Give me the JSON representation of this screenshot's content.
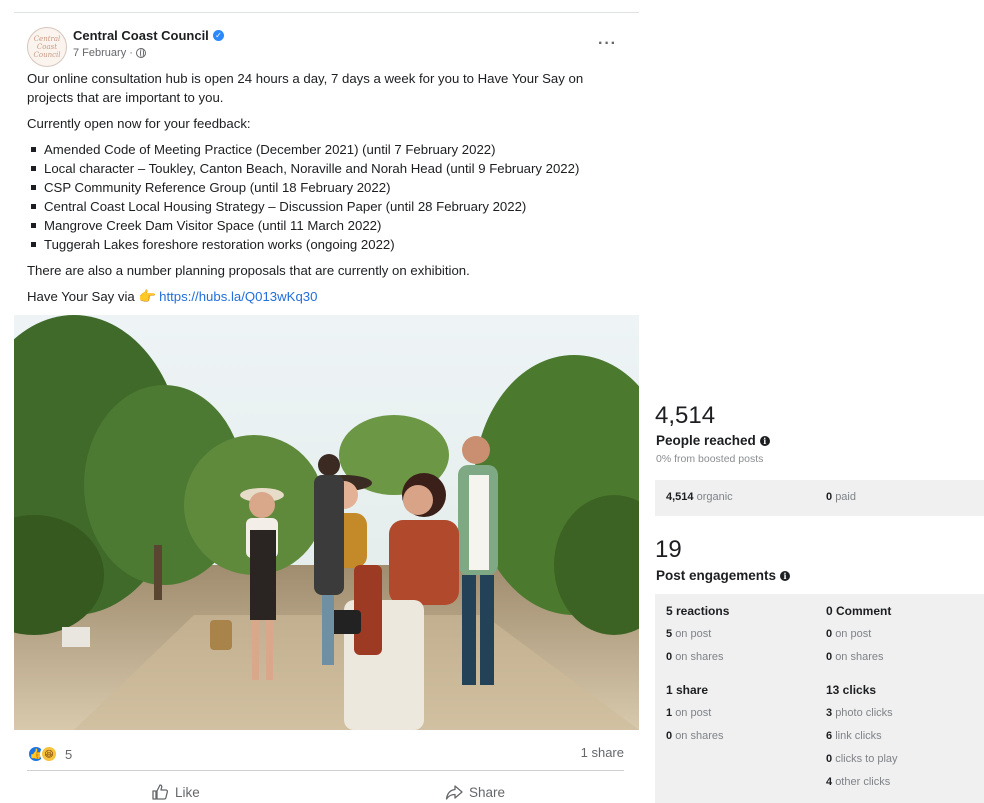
{
  "post": {
    "author": "Central Coast Council",
    "avatar_text": "Central Coast Council",
    "date": "7 February",
    "meta_sep": "·",
    "intro": "Our online consultation hub is open 24 hours a day, 7 days a week for you to Have Your Say on projects that are important to you.",
    "open_heading": "Currently open now for your feedback:",
    "items": [
      "Amended Code of Meeting Practice (December 2021) (until 7 February 2022)",
      "Local character – Toukley, Canton Beach, Noraville and Norah Head (until 9 February 2022)",
      "CSP Community Reference Group (until 18 February 2022)",
      "Central Coast Local Housing Strategy – Discussion Paper (until 28 February 2022)",
      "Mangrove Creek Dam Visitor Space (until 11 March 2022)",
      "Tuggerah Lakes foreshore restoration works (ongoing 2022)"
    ],
    "exhibition": "There are also a number planning proposals that are currently on exhibition.",
    "cta_prefix": "Have Your Say via",
    "cta_icon": "👉",
    "cta_link": "https://hubs.la/Q013wKq30",
    "reaction_count": "5",
    "share_count": "1 share",
    "like_label": "Like",
    "share_label": "Share",
    "more_label": "···"
  },
  "insights": {
    "reach": {
      "value": "4,514",
      "title": "People reached",
      "boosted": "0% from boosted posts",
      "organic_value": "4,514",
      "organic_label": "organic",
      "paid_value": "0",
      "paid_label": "paid"
    },
    "engagement": {
      "value": "19",
      "title": "Post engagements",
      "reactions_head": "5 reactions",
      "reactions_on_post_value": "5",
      "reactions_on_post_label": "on post",
      "reactions_on_shares_value": "0",
      "reactions_on_shares_label": "on shares",
      "comment_head": "0 Comment",
      "comment_on_post_value": "0",
      "comment_on_post_label": "on post",
      "comment_on_shares_value": "0",
      "comment_on_shares_label": "on shares",
      "share_head": "1 share",
      "share_on_post_value": "1",
      "share_on_post_label": "on post",
      "share_on_shares_value": "0",
      "share_on_shares_label": "on shares",
      "clicks_head": "13 clicks",
      "photo_clicks_value": "3",
      "photo_clicks_label": "photo clicks",
      "link_clicks_value": "6",
      "link_clicks_label": "link clicks",
      "play_clicks_value": "0",
      "play_clicks_label": "clicks to play",
      "other_clicks_value": "4",
      "other_clicks_label": "other clicks"
    }
  },
  "colors": {
    "link": "#216fdb",
    "verified": "#2d88ff",
    "like_reaction": "#1b74e4",
    "haha_reaction": "#f7c23c",
    "panel_grey": "#f0f0f0"
  },
  "icons": [
    "verified-badge-icon",
    "globe-icon",
    "more-options-icon",
    "pointing-hand-icon",
    "like-reaction-icon",
    "haha-reaction-icon",
    "thumbs-up-icon",
    "share-arrow-icon",
    "info-icon"
  ]
}
